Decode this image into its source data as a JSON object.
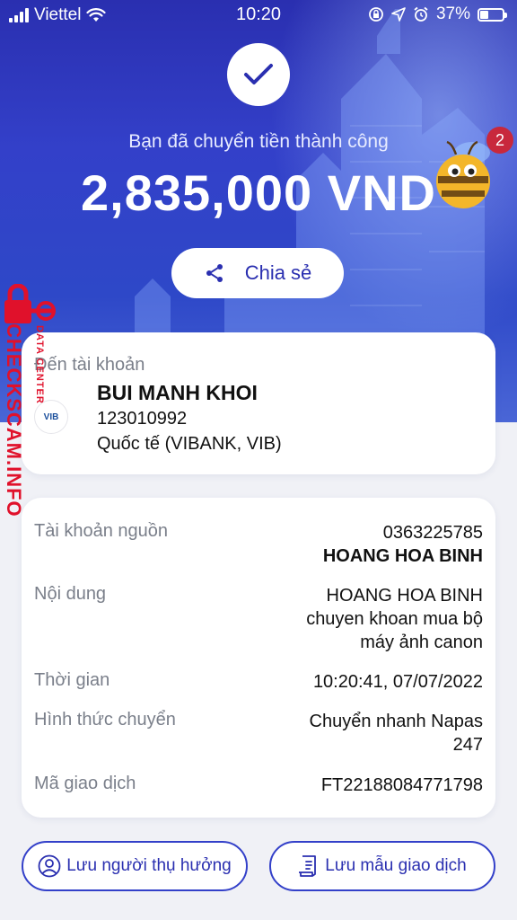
{
  "status_bar": {
    "carrier": "Viettel",
    "time": "10:20",
    "battery": "37%",
    "battery_level": 0.37
  },
  "success": {
    "message": "Bạn đã chuyển tiền thành công",
    "amount": "2,835,000 VND",
    "share_label": "Chia sẻ",
    "notification_count": "2"
  },
  "recipient": {
    "label": "Đến tài khoản",
    "name": "BUI MANH KHOI",
    "account": "123010992",
    "bank": "Quốc tế (VIBANK, VIB)",
    "bank_logo_text": "VIB"
  },
  "details": {
    "source_label": "Tài khoản nguồn",
    "source_account": "0363225785",
    "source_name": "HOANG HOA BINH",
    "content_label": "Nội dung",
    "content_lines": [
      "HOANG HOA BINH",
      "chuyen khoan mua bộ",
      "máy ảnh canon"
    ],
    "time_label": "Thời gian",
    "time_value": "10:20:41, 07/07/2022",
    "method_label": "Hình thức chuyển",
    "method_lines": [
      "Chuyển nhanh Napas",
      "247"
    ],
    "txn_label": "Mã giao dịch",
    "txn_value": "FT22188084771798"
  },
  "actions": {
    "save_beneficiary": "Lưu người thụ hưởng",
    "save_template": "Lưu mẫu giao dịch"
  },
  "watermark": {
    "main": "CHECKSCAM.INFO",
    "small": "DATA CENTER"
  },
  "colors": {
    "brand": "#2a2fb0",
    "hero_top": "#2a2fb0",
    "badge": "#c8283c",
    "watermark": "#e0112b"
  }
}
